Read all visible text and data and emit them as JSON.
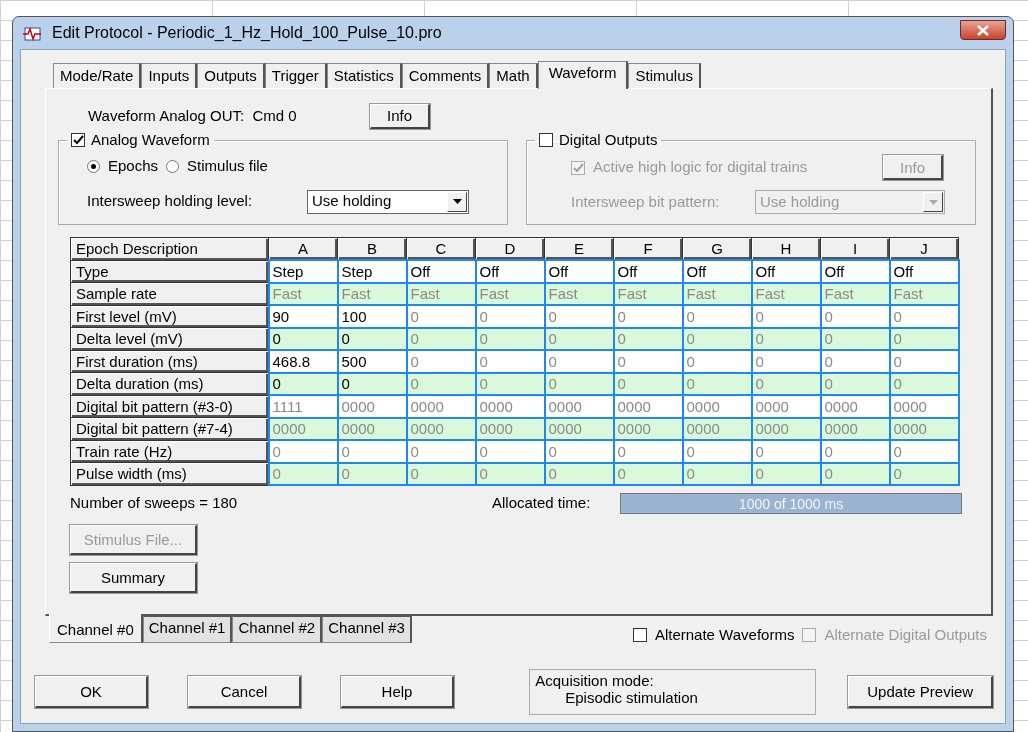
{
  "window": {
    "title": "Edit Protocol - Periodic_1_Hz_Hold_100_Pulse_10.pro"
  },
  "tabs": [
    {
      "label": "Mode/Rate",
      "selected": false
    },
    {
      "label": "Inputs",
      "selected": false
    },
    {
      "label": "Outputs",
      "selected": false
    },
    {
      "label": "Trigger",
      "selected": false
    },
    {
      "label": "Statistics",
      "selected": false
    },
    {
      "label": "Comments",
      "selected": false
    },
    {
      "label": "Math",
      "selected": false
    },
    {
      "label": "Waveform",
      "selected": true
    },
    {
      "label": "Stimulus",
      "selected": false
    }
  ],
  "waveform_header": {
    "label": "Waveform Analog OUT:  Cmd 0",
    "button": "Info"
  },
  "analog_group": {
    "label": "Analog Waveform",
    "checked": true,
    "radios": [
      {
        "label": "Epochs",
        "selected": true
      },
      {
        "label": "Stimulus file",
        "selected": false
      }
    ],
    "holding_label": "Intersweep holding level:",
    "holding_value": "Use holding"
  },
  "digital_group": {
    "label": "Digital Outputs",
    "checked": false,
    "active_high": {
      "label": "Active high logic for digital trains",
      "checked": true,
      "disabled": true
    },
    "info_button": {
      "label": "Info",
      "disabled": true
    },
    "pattern_label": "Intersweep bit pattern:",
    "pattern_value": "Use holding",
    "disabled": true
  },
  "epoch_table": {
    "row_header_title": "Epoch Description",
    "columns": [
      "A",
      "B",
      "C",
      "D",
      "E",
      "F",
      "G",
      "H",
      "I",
      "J"
    ],
    "rows": [
      {
        "label": "Type",
        "cells": [
          {
            "text": "Step",
            "enabled": true
          },
          {
            "text": "Step",
            "enabled": true
          },
          {
            "text": "Off",
            "enabled": true
          },
          {
            "text": "Off",
            "enabled": true
          },
          {
            "text": "Off",
            "enabled": true
          },
          {
            "text": "Off",
            "enabled": true
          },
          {
            "text": "Off",
            "enabled": true
          },
          {
            "text": "Off",
            "enabled": true
          },
          {
            "text": "Off",
            "enabled": true
          },
          {
            "text": "Off",
            "enabled": true
          }
        ]
      },
      {
        "label": "Sample rate",
        "cells": [
          {
            "text": "Fast",
            "enabled": false
          },
          {
            "text": "Fast",
            "enabled": false
          },
          {
            "text": "Fast",
            "enabled": false
          },
          {
            "text": "Fast",
            "enabled": false
          },
          {
            "text": "Fast",
            "enabled": false
          },
          {
            "text": "Fast",
            "enabled": false
          },
          {
            "text": "Fast",
            "enabled": false
          },
          {
            "text": "Fast",
            "enabled": false
          },
          {
            "text": "Fast",
            "enabled": false
          },
          {
            "text": "Fast",
            "enabled": false
          }
        ]
      },
      {
        "label": "First level (mV)",
        "cells": [
          {
            "text": "90",
            "enabled": true
          },
          {
            "text": "100",
            "enabled": true
          },
          {
            "text": "0",
            "enabled": false
          },
          {
            "text": "0",
            "enabled": false
          },
          {
            "text": "0",
            "enabled": false
          },
          {
            "text": "0",
            "enabled": false
          },
          {
            "text": "0",
            "enabled": false
          },
          {
            "text": "0",
            "enabled": false
          },
          {
            "text": "0",
            "enabled": false
          },
          {
            "text": "0",
            "enabled": false
          }
        ]
      },
      {
        "label": "Delta level (mV)",
        "cells": [
          {
            "text": "0",
            "enabled": true
          },
          {
            "text": "0",
            "enabled": true
          },
          {
            "text": "0",
            "enabled": false
          },
          {
            "text": "0",
            "enabled": false
          },
          {
            "text": "0",
            "enabled": false
          },
          {
            "text": "0",
            "enabled": false
          },
          {
            "text": "0",
            "enabled": false
          },
          {
            "text": "0",
            "enabled": false
          },
          {
            "text": "0",
            "enabled": false
          },
          {
            "text": "0",
            "enabled": false
          }
        ]
      },
      {
        "label": "First duration (ms)",
        "cells": [
          {
            "text": "468.8",
            "enabled": true
          },
          {
            "text": "500",
            "enabled": true
          },
          {
            "text": "0",
            "enabled": false
          },
          {
            "text": "0",
            "enabled": false
          },
          {
            "text": "0",
            "enabled": false
          },
          {
            "text": "0",
            "enabled": false
          },
          {
            "text": "0",
            "enabled": false
          },
          {
            "text": "0",
            "enabled": false
          },
          {
            "text": "0",
            "enabled": false
          },
          {
            "text": "0",
            "enabled": false
          }
        ]
      },
      {
        "label": "Delta duration (ms)",
        "cells": [
          {
            "text": "0",
            "enabled": true
          },
          {
            "text": "0",
            "enabled": true
          },
          {
            "text": "0",
            "enabled": false
          },
          {
            "text": "0",
            "enabled": false
          },
          {
            "text": "0",
            "enabled": false
          },
          {
            "text": "0",
            "enabled": false
          },
          {
            "text": "0",
            "enabled": false
          },
          {
            "text": "0",
            "enabled": false
          },
          {
            "text": "0",
            "enabled": false
          },
          {
            "text": "0",
            "enabled": false
          }
        ]
      },
      {
        "label": "Digital bit pattern (#3-0)",
        "cells": [
          {
            "text": "1111",
            "enabled": false
          },
          {
            "text": "0000",
            "enabled": false
          },
          {
            "text": "0000",
            "enabled": false
          },
          {
            "text": "0000",
            "enabled": false
          },
          {
            "text": "0000",
            "enabled": false
          },
          {
            "text": "0000",
            "enabled": false
          },
          {
            "text": "0000",
            "enabled": false
          },
          {
            "text": "0000",
            "enabled": false
          },
          {
            "text": "0000",
            "enabled": false
          },
          {
            "text": "0000",
            "enabled": false
          }
        ]
      },
      {
        "label": "Digital bit pattern (#7-4)",
        "cells": [
          {
            "text": "0000",
            "enabled": false
          },
          {
            "text": "0000",
            "enabled": false
          },
          {
            "text": "0000",
            "enabled": false
          },
          {
            "text": "0000",
            "enabled": false
          },
          {
            "text": "0000",
            "enabled": false
          },
          {
            "text": "0000",
            "enabled": false
          },
          {
            "text": "0000",
            "enabled": false
          },
          {
            "text": "0000",
            "enabled": false
          },
          {
            "text": "0000",
            "enabled": false
          },
          {
            "text": "0000",
            "enabled": false
          }
        ]
      },
      {
        "label": "Train rate (Hz)",
        "cells": [
          {
            "text": "0",
            "enabled": false
          },
          {
            "text": "0",
            "enabled": false
          },
          {
            "text": "0",
            "enabled": false
          },
          {
            "text": "0",
            "enabled": false
          },
          {
            "text": "0",
            "enabled": false
          },
          {
            "text": "0",
            "enabled": false
          },
          {
            "text": "0",
            "enabled": false
          },
          {
            "text": "0",
            "enabled": false
          },
          {
            "text": "0",
            "enabled": false
          },
          {
            "text": "0",
            "enabled": false
          }
        ]
      },
      {
        "label": "Pulse width (ms)",
        "cells": [
          {
            "text": "0",
            "enabled": false
          },
          {
            "text": "0",
            "enabled": false
          },
          {
            "text": "0",
            "enabled": false
          },
          {
            "text": "0",
            "enabled": false
          },
          {
            "text": "0",
            "enabled": false
          },
          {
            "text": "0",
            "enabled": false
          },
          {
            "text": "0",
            "enabled": false
          },
          {
            "text": "0",
            "enabled": false
          },
          {
            "text": "0",
            "enabled": false
          },
          {
            "text": "0",
            "enabled": false
          }
        ]
      }
    ]
  },
  "sweeps_text": "Number of sweeps = 180",
  "allocated": {
    "label": "Allocated time:",
    "level": 1,
    "reading": "1000 of 1000 ms"
  },
  "side_buttons": [
    {
      "label": "Stimulus File...",
      "disabled": true
    },
    {
      "label": "Summary",
      "disabled": false
    }
  ],
  "channel_tabs": [
    {
      "label": "Channel #0",
      "selected": true
    },
    {
      "label": "Channel #1",
      "selected": false
    },
    {
      "label": "Channel #2",
      "selected": false
    },
    {
      "label": "Channel #3",
      "selected": false
    }
  ],
  "options": [
    {
      "label": "Alternate Waveforms",
      "checked": false,
      "disabled": false
    },
    {
      "label": "Alternate Digital Outputs",
      "checked": false,
      "disabled": true
    }
  ],
  "buttons": [
    "OK",
    "Cancel",
    "Help"
  ],
  "acquisition": {
    "label": "Acquisition mode:",
    "value": "Episodic stimulation"
  },
  "preview_button": "Update Preview"
}
